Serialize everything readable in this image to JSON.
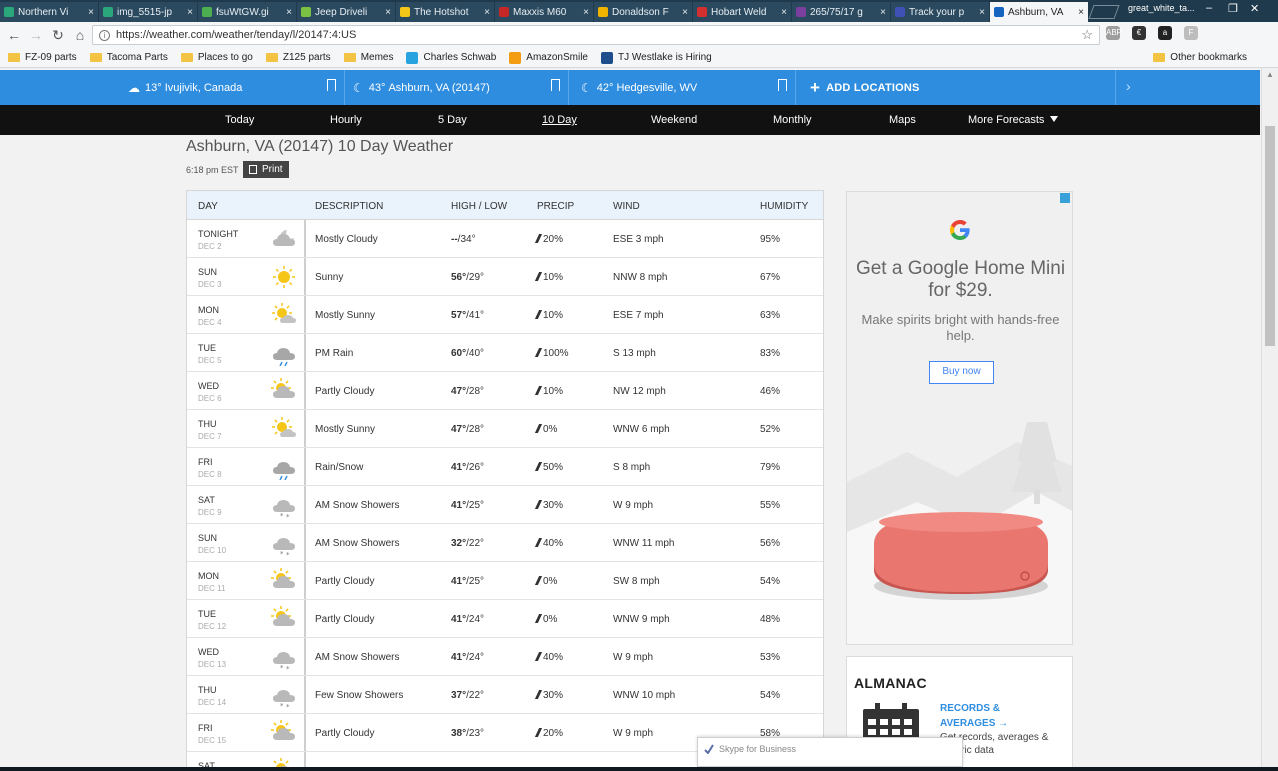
{
  "browser": {
    "tabs": [
      {
        "label": "Northern Vi",
        "color": "#2aa87c"
      },
      {
        "label": "img_5515-jp",
        "color": "#2aa87c"
      },
      {
        "label": "fsuWtGW.gi",
        "color": "#4caf50"
      },
      {
        "label": "Jeep Driveli",
        "color": "#7cc242"
      },
      {
        "label": "The Hotshot",
        "color": "#f5c518"
      },
      {
        "label": "Maxxis M60",
        "color": "#c62828"
      },
      {
        "label": "Donaldson F",
        "color": "#f0b400"
      },
      {
        "label": "Hobart Weld",
        "color": "#d32f2f"
      },
      {
        "label": "265/75/17 g",
        "color": "#7b3fa0"
      },
      {
        "label": "Track your p",
        "color": "#3f51b5"
      },
      {
        "label": "Ashburn, VA",
        "color": "#1565c0"
      }
    ],
    "tab_close": "×",
    "profile_name": "great_white_ta...",
    "window_controls": {
      "minimize": "–",
      "restore": "❐",
      "close": "✕"
    },
    "url": "https://weather.com/weather/tenday/l/20147:4:US",
    "star": "☆",
    "info": "i",
    "back": "←",
    "forward": "→",
    "reload": "↻",
    "home": "⌂",
    "extensions": [
      {
        "label": "ABP",
        "color": "#9e9e9e"
      },
      {
        "label": "€",
        "color": "#333333"
      },
      {
        "label": "a",
        "color": "#222222"
      },
      {
        "label": "F",
        "color": "#bdbdbd"
      }
    ],
    "bookmarks": [
      {
        "label": "FZ-09 parts",
        "kind": "folder"
      },
      {
        "label": "Tacoma Parts",
        "kind": "folder"
      },
      {
        "label": "Places to go",
        "kind": "folder"
      },
      {
        "label": "Z125 parts",
        "kind": "folder"
      },
      {
        "label": "Memes",
        "kind": "folder"
      },
      {
        "label": "Charles Schwab",
        "kind": "site",
        "color": "#29a3e0"
      },
      {
        "label": "AmazonSmile",
        "kind": "site",
        "color": "#f39c12"
      },
      {
        "label": "TJ Westlake is Hiring",
        "kind": "site",
        "color": "#1e4f8c"
      }
    ],
    "other_bookmarks": "Other bookmarks"
  },
  "locations": [
    {
      "temp": "13°",
      "name": "Ivujivik, Canada",
      "icon": "cloud-icon"
    },
    {
      "temp": "43°",
      "name": "Ashburn, VA (20147)",
      "icon": "moon-icon"
    },
    {
      "temp": "42°",
      "name": "Hedgesville, WV",
      "icon": "moon-icon"
    }
  ],
  "add_locations": "ADD LOCATIONS",
  "nav": {
    "items": [
      "Today",
      "Hourly",
      "5 Day",
      "10 Day",
      "Weekend",
      "Monthly",
      "Maps",
      "More Forecasts"
    ],
    "active": "10 Day"
  },
  "page": {
    "title": "Ashburn, VA (20147) 10 Day Weather",
    "timestamp": "6:18 pm EST",
    "print": "Print"
  },
  "table": {
    "headers": {
      "day": "DAY",
      "description": "DESCRIPTION",
      "highlow": "HIGH / LOW",
      "precip": "PRECIP",
      "wind": "WIND",
      "humidity": "HUMIDITY"
    },
    "rows": [
      {
        "day": "TONIGHT",
        "date": "DEC 2",
        "icon": "mostly-cloudy-night",
        "desc": "Mostly Cloudy",
        "high": "--",
        "low": "34°",
        "precip": "20%",
        "wind": "ESE 3 mph",
        "humidity": "95%"
      },
      {
        "day": "SUN",
        "date": "DEC 3",
        "icon": "sunny",
        "desc": "Sunny",
        "high": "56°",
        "low": "29°",
        "precip": "10%",
        "wind": "NNW 8 mph",
        "humidity": "67%"
      },
      {
        "day": "MON",
        "date": "DEC 4",
        "icon": "mostly-sunny",
        "desc": "Mostly Sunny",
        "high": "57°",
        "low": "41°",
        "precip": "10%",
        "wind": "ESE 7 mph",
        "humidity": "63%"
      },
      {
        "day": "TUE",
        "date": "DEC 5",
        "icon": "rain",
        "desc": "PM Rain",
        "high": "60°",
        "low": "40°",
        "precip": "100%",
        "wind": "S 13 mph",
        "humidity": "83%"
      },
      {
        "day": "WED",
        "date": "DEC 6",
        "icon": "partly-cloudy",
        "desc": "Partly Cloudy",
        "high": "47°",
        "low": "28°",
        "precip": "10%",
        "wind": "NW 12 mph",
        "humidity": "46%"
      },
      {
        "day": "THU",
        "date": "DEC 7",
        "icon": "mostly-sunny",
        "desc": "Mostly Sunny",
        "high": "47°",
        "low": "28°",
        "precip": "0%",
        "wind": "WNW 6 mph",
        "humidity": "52%"
      },
      {
        "day": "FRI",
        "date": "DEC 8",
        "icon": "rain",
        "desc": "Rain/Snow",
        "high": "41°",
        "low": "26°",
        "precip": "50%",
        "wind": "S 8 mph",
        "humidity": "79%"
      },
      {
        "day": "SAT",
        "date": "DEC 9",
        "icon": "snow",
        "desc": "AM Snow Showers",
        "high": "41°",
        "low": "25°",
        "precip": "30%",
        "wind": "W 9 mph",
        "humidity": "55%"
      },
      {
        "day": "SUN",
        "date": "DEC 10",
        "icon": "snow",
        "desc": "AM Snow Showers",
        "high": "32°",
        "low": "22°",
        "precip": "40%",
        "wind": "WNW 11 mph",
        "humidity": "56%"
      },
      {
        "day": "MON",
        "date": "DEC 11",
        "icon": "partly-cloudy",
        "desc": "Partly Cloudy",
        "high": "41°",
        "low": "25°",
        "precip": "0%",
        "wind": "SW 8 mph",
        "humidity": "54%"
      },
      {
        "day": "TUE",
        "date": "DEC 12",
        "icon": "partly-cloudy",
        "desc": "Partly Cloudy",
        "high": "41°",
        "low": "24°",
        "precip": "0%",
        "wind": "WNW 9 mph",
        "humidity": "48%"
      },
      {
        "day": "WED",
        "date": "DEC 13",
        "icon": "snow",
        "desc": "AM Snow Showers",
        "high": "41°",
        "low": "24°",
        "precip": "40%",
        "wind": "W 9 mph",
        "humidity": "53%"
      },
      {
        "day": "THU",
        "date": "DEC 14",
        "icon": "snow",
        "desc": "Few Snow Showers",
        "high": "37°",
        "low": "22°",
        "precip": "30%",
        "wind": "WNW 10 mph",
        "humidity": "54%"
      },
      {
        "day": "FRI",
        "date": "DEC 15",
        "icon": "partly-cloudy",
        "desc": "Partly Cloudy",
        "high": "38°",
        "low": "23°",
        "precip": "20%",
        "wind": "W 9 mph",
        "humidity": "58%"
      },
      {
        "day": "SAT",
        "date": "",
        "icon": "partly-cloudy",
        "desc": "",
        "high": "",
        "low": "",
        "precip": "",
        "wind": "",
        "humidity": ""
      }
    ]
  },
  "ad": {
    "headline": "Get a Google Home Mini for $29.",
    "sub": "Make spirits bright with hands-free help.",
    "button": "Buy now"
  },
  "almanac": {
    "title": "ALMANAC",
    "link": "RECORDS & AVERAGES →",
    "desc": "Get records, averages & historic data"
  },
  "skype": "Skype for Business"
}
